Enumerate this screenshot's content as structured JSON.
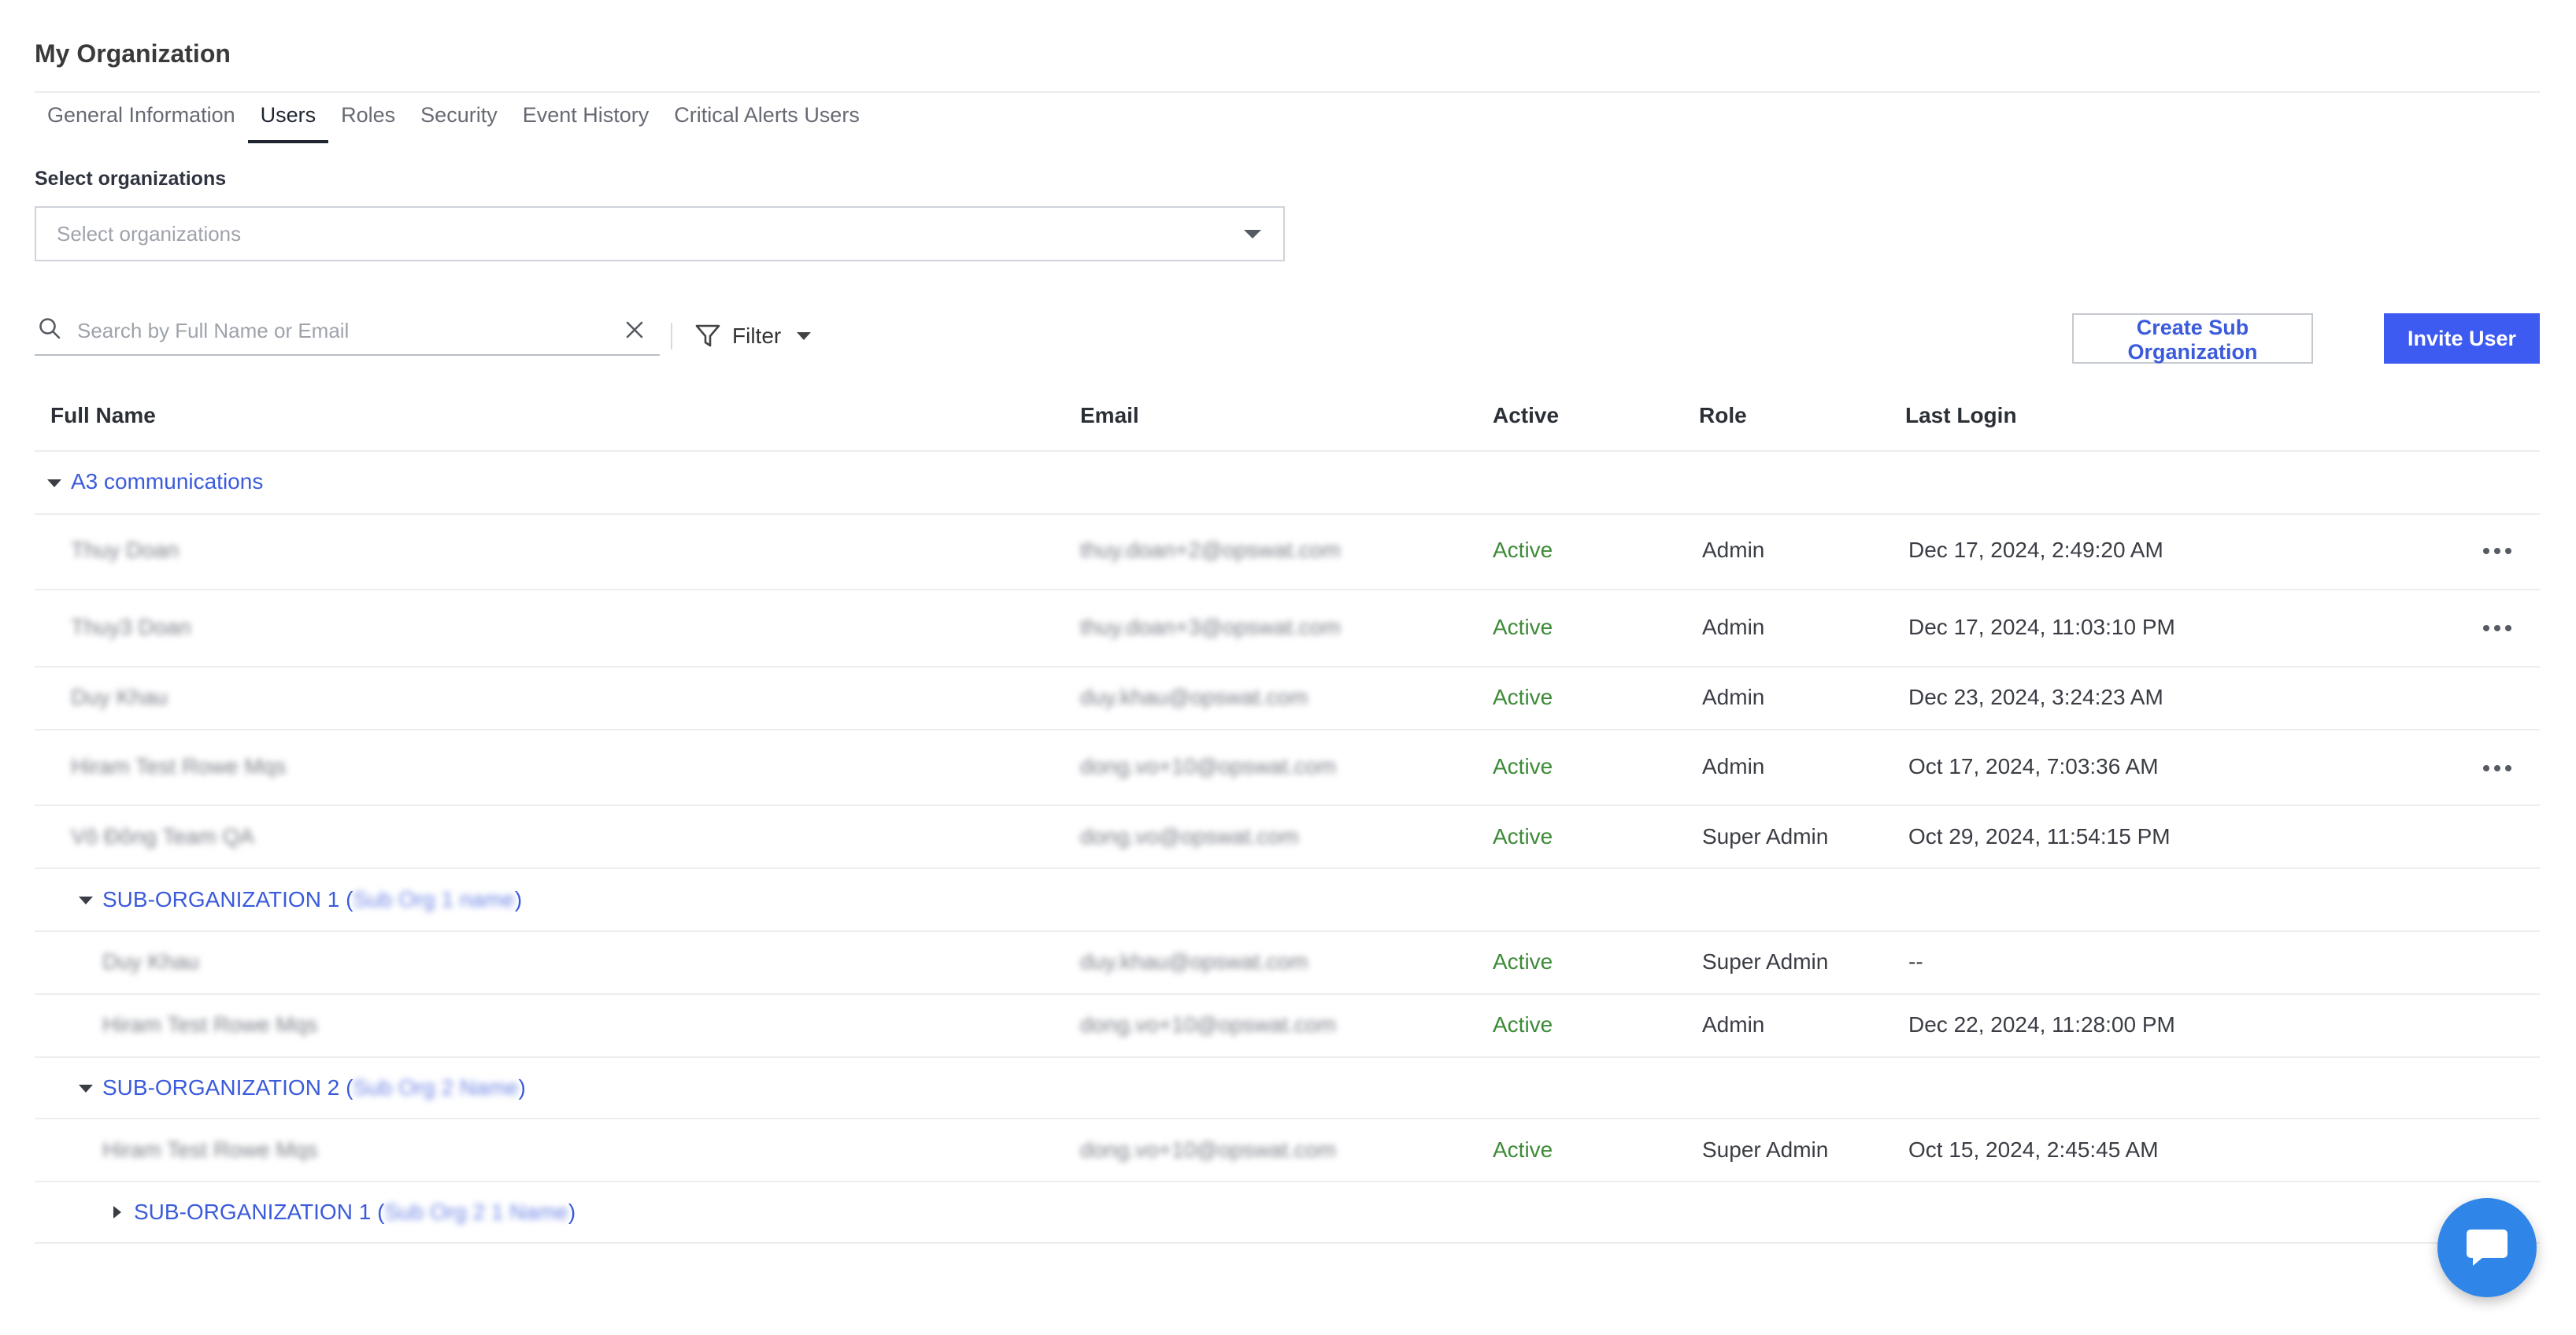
{
  "page": {
    "title": "My Organization"
  },
  "tabs": [
    {
      "label": "General Information"
    },
    {
      "label": "Users",
      "active": true
    },
    {
      "label": "Roles"
    },
    {
      "label": "Security"
    },
    {
      "label": "Event History"
    },
    {
      "label": "Critical Alerts Users"
    }
  ],
  "org_select": {
    "label": "Select organizations",
    "placeholder": "Select organizations"
  },
  "search": {
    "placeholder": "Search by Full Name or Email",
    "value": ""
  },
  "filter": {
    "label": "Filter"
  },
  "buttons": {
    "create_sub_org": "Create Sub Organization",
    "invite_user": "Invite User"
  },
  "colors": {
    "primary": "#3d5af1",
    "link": "#3b5bdb",
    "active_status": "#3d8b37",
    "chat": "#2f86e8"
  },
  "table": {
    "columns": [
      "Full Name",
      "Email",
      "Active",
      "Role",
      "Last Login"
    ],
    "groups": {
      "root": {
        "name": "A3 communications"
      },
      "sub1": {
        "name": "SUB-ORGANIZATION 1",
        "paren_open": " (",
        "alias": "Sub Org 1 name",
        "paren_close": ")"
      },
      "sub2": {
        "name": "SUB-ORGANIZATION 2",
        "paren_open": " (",
        "alias": "Sub Org 2 Name",
        "paren_close": ")"
      },
      "sub2_1": {
        "name": "SUB-ORGANIZATION 1",
        "paren_open": " (",
        "alias": "Sub Org 2 1 Name",
        "paren_close": ")"
      }
    },
    "rows": [
      {
        "name": "Thuy Doan",
        "email": "thuy.doan+2@opswat.com",
        "active": "Active",
        "role": "Admin",
        "last_login": "Dec 17, 2024, 2:49:20 AM"
      },
      {
        "name": "Thuy3 Doan",
        "email": "thuy.doan+3@opswat.com",
        "active": "Active",
        "role": "Admin",
        "last_login": "Dec 17, 2024, 11:03:10 PM"
      },
      {
        "name": "Duy Khau",
        "email": "duy.khau@opswat.com",
        "active": "Active",
        "role": "Admin",
        "last_login": "Dec 23, 2024, 3:24:23 AM"
      },
      {
        "name": "Hiram Test Rowe Mqs",
        "email": "dong.vo+10@opswat.com",
        "active": "Active",
        "role": "Admin",
        "last_login": "Oct 17, 2024, 7:03:36 AM"
      },
      {
        "name": "Vô Đông Team QA",
        "email": "dong.vo@opswat.com",
        "active": "Active",
        "role": "Super Admin",
        "last_login": "Oct 29, 2024, 11:54:15 PM"
      },
      {
        "name": "Duy Khau",
        "email": "duy.khau@opswat.com",
        "active": "Active",
        "role": "Super Admin",
        "last_login": "--"
      },
      {
        "name": "Hiram Test Rowe Mqs",
        "email": "dong.vo+10@opswat.com",
        "active": "Active",
        "role": "Admin",
        "last_login": "Dec 22, 2024, 11:28:00 PM"
      },
      {
        "name": "Hiram Test Rowe Mqs",
        "email": "dong.vo+10@opswat.com",
        "active": "Active",
        "role": "Super Admin",
        "last_login": "Oct 15, 2024, 2:45:45 AM"
      }
    ]
  }
}
